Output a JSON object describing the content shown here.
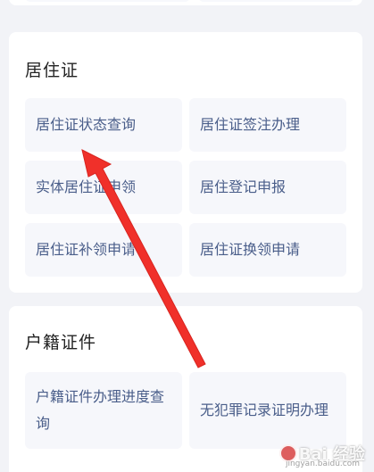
{
  "residence_section": {
    "title": "居住证",
    "items": [
      {
        "label": "居住证状态查询"
      },
      {
        "label": "居住证签注办理"
      },
      {
        "label": "实体居住证申领"
      },
      {
        "label": "居住登记申报"
      },
      {
        "label": "居住证补领申请"
      },
      {
        "label": "居住证换领申请"
      }
    ]
  },
  "huji_section": {
    "title": "户籍证件",
    "items": [
      {
        "label": "户籍证件办理进度查询"
      },
      {
        "label": "无犯罪记录证明办理"
      }
    ]
  },
  "annotation": {
    "arrow_color": "#f0302a",
    "icon": "red-arrow-icon"
  },
  "watermark": {
    "text": "Bai 经验",
    "sub": "jingyan.baidu.com",
    "icon": "baidu-paw-icon"
  }
}
